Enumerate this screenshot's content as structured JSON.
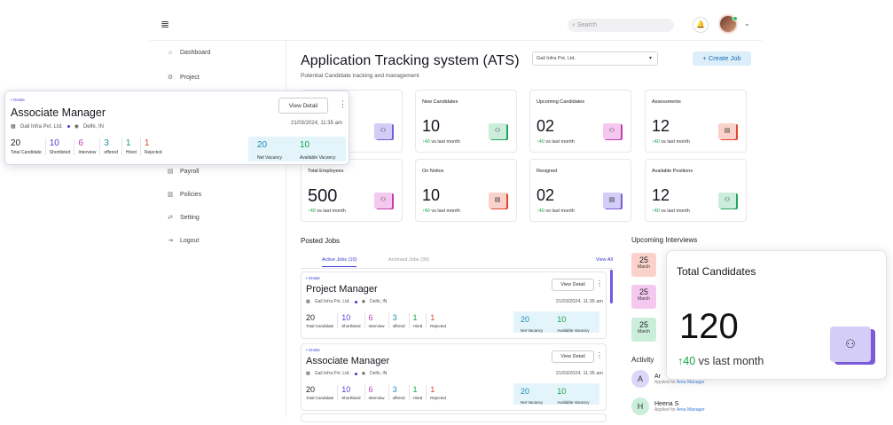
{
  "header": {
    "search_placeholder": "Search",
    "menu_icon": "≣",
    "bell_icon": "🔔",
    "chevron": "⌄"
  },
  "sidebar": {
    "items": [
      {
        "label": "Dashboard",
        "icon": "⌂"
      },
      {
        "label": "Project",
        "icon": "⚙"
      },
      {
        "label": "Payroll",
        "icon": "▤"
      },
      {
        "label": "Policies",
        "icon": "▥"
      },
      {
        "label": "Setting",
        "icon": "⇄"
      },
      {
        "label": "Logout",
        "icon": "⇥"
      }
    ]
  },
  "page": {
    "title": "Application Tracking system (ATS)",
    "subtitle": "Potential Candidate tracking and management",
    "company_select": "Gail Infra Pvt. Ltd.",
    "create_job": "+ Create Job"
  },
  "stats": [
    {
      "label": "New Candidates",
      "value": "10",
      "delta": "↑40",
      "delta_text": "vs last month"
    },
    {
      "label": "Upcoming Candidates",
      "value": "02",
      "delta": "↑40",
      "delta_text": "vs last month"
    },
    {
      "label": "Assessments",
      "value": "12",
      "delta": "↑40",
      "delta_text": "vs last month"
    },
    {
      "label": "Total Employees",
      "value": "500",
      "delta": "↑40",
      "delta_text": "vs last month"
    },
    {
      "label": "On Notice",
      "value": "10",
      "delta": "↑40",
      "delta_text": "vs last month"
    },
    {
      "label": "Resigned",
      "value": "02",
      "delta": "↑40",
      "delta_text": "vs last month"
    },
    {
      "label": "Available Positions",
      "value": "12",
      "delta": "↑40",
      "delta_text": "vs last month"
    }
  ],
  "posted_jobs": {
    "title": "Posted Jobs",
    "tab_active": "Active Jobs (10)",
    "tab_archived": "Archived Jobs (30)",
    "view_all": "View All",
    "jobs": [
      {
        "tag": "• Onsite",
        "title": "Project Manager",
        "company": "Gail Infra Pvt. Ltd.",
        "location": "Delhi, IN",
        "view": "View Detail",
        "date": "21/03/2024, 11:35 am",
        "total": "20",
        "total_l": "Total Candidate",
        "shortlisted": "10",
        "shortlisted_l": "Shortlisted",
        "interview": "6",
        "interview_l": "Interview",
        "offered": "3",
        "offered_l": "offered",
        "hired": "1",
        "hired_l": "Hired",
        "rejected": "1",
        "rejected_l": "Rejected",
        "net": "20",
        "net_l": "Net Vacancy",
        "avail": "10",
        "avail_l": "Available Vacancy"
      },
      {
        "tag": "• Onsite",
        "title": "Associate Manager",
        "company": "Gail Infra Pvt. Ltd.",
        "location": "Delhi, IN",
        "view": "View Detail",
        "date": "21/03/2024, 11:35 am",
        "total": "20",
        "total_l": "Total Candidate",
        "shortlisted": "10",
        "shortlisted_l": "Shortlisted",
        "interview": "6",
        "interview_l": "Interview",
        "offered": "3",
        "offered_l": "offered",
        "hired": "1",
        "hired_l": "Hired",
        "rejected": "1",
        "rejected_l": "Rejected",
        "net": "20",
        "net_l": "Net Vacancy",
        "avail": "10",
        "avail_l": "Available Vacancy"
      }
    ]
  },
  "upcoming": {
    "title": "Upcoming Interviews",
    "dates": [
      {
        "day": "25",
        "month": "March"
      },
      {
        "day": "25",
        "month": "March"
      },
      {
        "day": "25",
        "month": "March"
      }
    ]
  },
  "activity": {
    "title": "Activity",
    "items": [
      {
        "initial": "A",
        "name": "Ar",
        "applied": "Applied for",
        "role": "Area Manager"
      },
      {
        "initial": "H",
        "name": "Heena S",
        "applied": "Applied for",
        "role": "Area Manager"
      }
    ]
  },
  "overlay_job": {
    "tag": "• Onsite",
    "title": "Associate Manager",
    "company": "Gail Infra Pvt. Ltd.",
    "location": "Delhi, IN",
    "view": "View Detail",
    "date": "21/03/2024, 11:35 am",
    "total": "20",
    "total_l": "Total Candidate",
    "shortlisted": "10",
    "shortlisted_l": "Shortlisted",
    "interview": "6",
    "interview_l": "Interview",
    "offered": "3",
    "offered_l": "offered",
    "hired": "1",
    "hired_l": "Hired",
    "rejected": "1",
    "rejected_l": "Rejected",
    "net": "20",
    "net_l": "Net Vacancy",
    "avail": "10",
    "avail_l": "Available Vacancy"
  },
  "overlay_total": {
    "label": "Total Candidates",
    "value": "120",
    "delta": "↑40",
    "delta_text": "vs last month"
  }
}
